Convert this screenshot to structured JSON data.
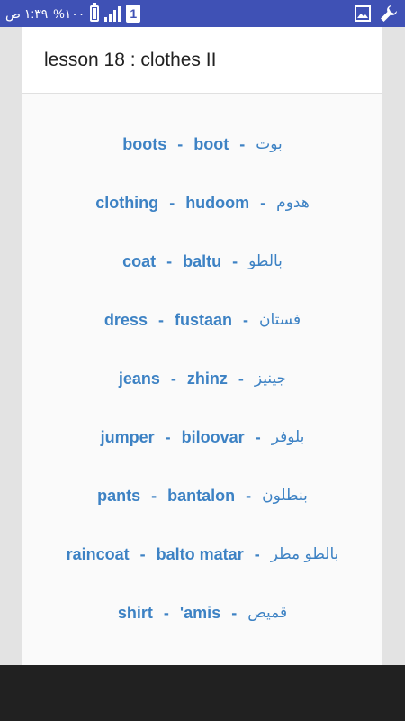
{
  "status_bar": {
    "time": "١:٣٩ ص",
    "battery_text": "%١٠٠",
    "sim_label": "1",
    "icons": [
      "battery-icon",
      "signal-icon",
      "sim-icon",
      "gallery-icon",
      "wrench-icon"
    ]
  },
  "header": {
    "title": "lesson 18 : clothes II"
  },
  "rows": [
    {
      "english": "boots",
      "translit": "boot",
      "arabic": "بوت"
    },
    {
      "english": "clothing",
      "translit": "hudoom",
      "arabic": "هدوم"
    },
    {
      "english": "coat",
      "translit": "baltu",
      "arabic": "بالطو"
    },
    {
      "english": "dress",
      "translit": "fustaan",
      "arabic": "فستان"
    },
    {
      "english": "jeans",
      "translit": "zhinz",
      "arabic": "جينيز"
    },
    {
      "english": "jumper",
      "translit": "biloovar",
      "arabic": "بلوفر"
    },
    {
      "english": "pants",
      "translit": "bantalon",
      "arabic": "بنطلون"
    },
    {
      "english": "raincoat",
      "translit": "balto matar",
      "arabic": "بالطو مطر"
    },
    {
      "english": "shirt",
      "translit": "'amis",
      "arabic": "قميص"
    }
  ],
  "separator": "-",
  "colors": {
    "status_bar": "#3f51b5",
    "word_text": "#3d82c4",
    "nav_bar": "#212121"
  }
}
